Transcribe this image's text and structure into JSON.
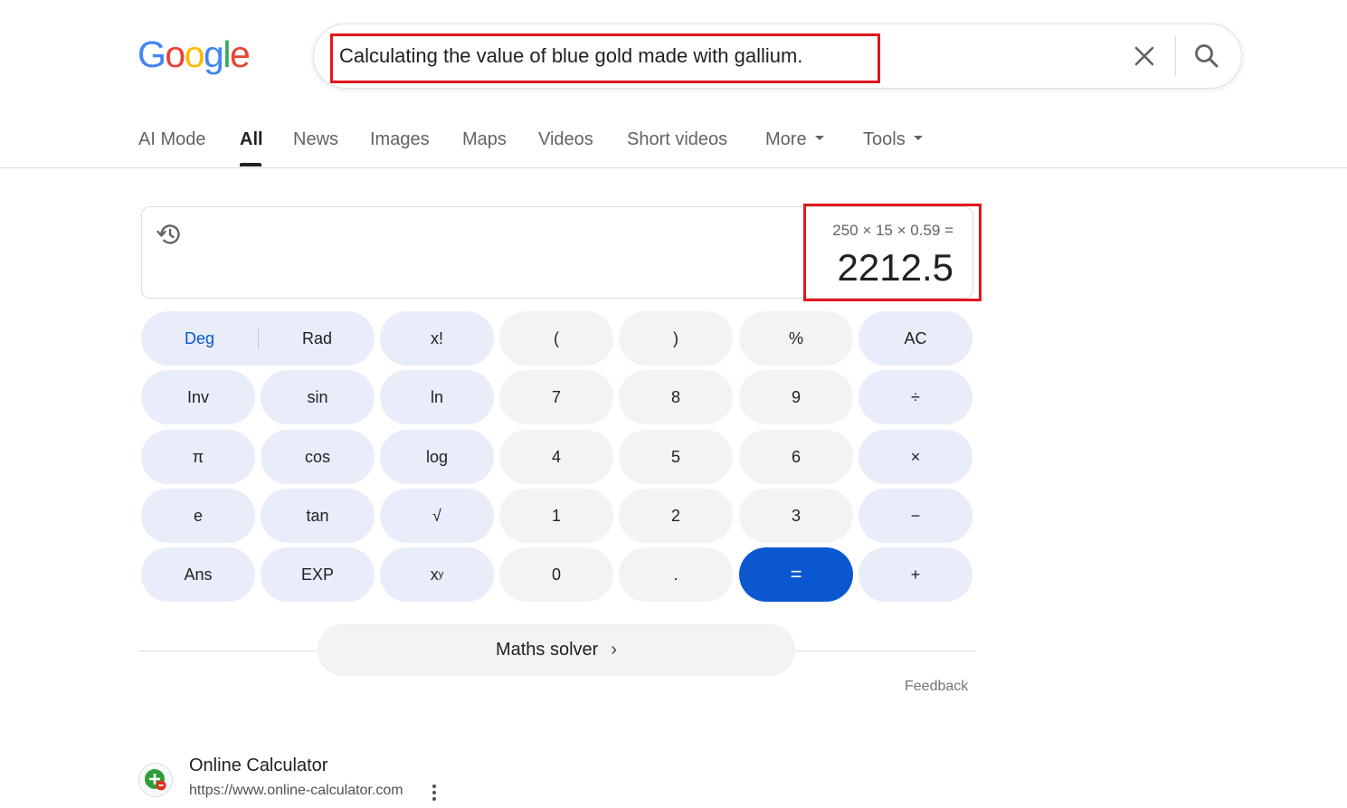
{
  "logo": {
    "letters": [
      "G",
      "o",
      "o",
      "g",
      "l",
      "e"
    ]
  },
  "search": {
    "query": "Calculating the value of blue gold made with gallium."
  },
  "tabs": [
    {
      "label": "AI Mode"
    },
    {
      "label": "All"
    },
    {
      "label": "News"
    },
    {
      "label": "Images"
    },
    {
      "label": "Maps"
    },
    {
      "label": "Videos"
    },
    {
      "label": "Short videos"
    },
    {
      "label": "More"
    },
    {
      "label": "Tools"
    }
  ],
  "calculator": {
    "expression": "250 × 15 × 0.59 =",
    "result": "2212.5",
    "angle": {
      "deg": "Deg",
      "rad": "Rad",
      "selected": "Deg"
    },
    "keys": {
      "fact": "x!",
      "lparen": "(",
      "rparen": ")",
      "percent": "%",
      "ac": "AC",
      "inv": "Inv",
      "sin": "sin",
      "ln": "ln",
      "seven": "7",
      "eight": "8",
      "nine": "9",
      "divide": "÷",
      "pi": "π",
      "cos": "cos",
      "log": "log",
      "four": "4",
      "five": "5",
      "six": "6",
      "multiply": "×",
      "e": "e",
      "tan": "tan",
      "sqrt": "√",
      "one": "1",
      "two": "2",
      "three": "3",
      "minus": "−",
      "ans": "Ans",
      "exp": "EXP",
      "pow_base": "x",
      "pow_exp": "y",
      "zero": "0",
      "dot": ".",
      "equals": "=",
      "plus": "+"
    },
    "solver": "Maths solver",
    "feedback": "Feedback"
  },
  "result": {
    "title": "Online Calculator",
    "url": "https://www.online-calculator.com"
  }
}
